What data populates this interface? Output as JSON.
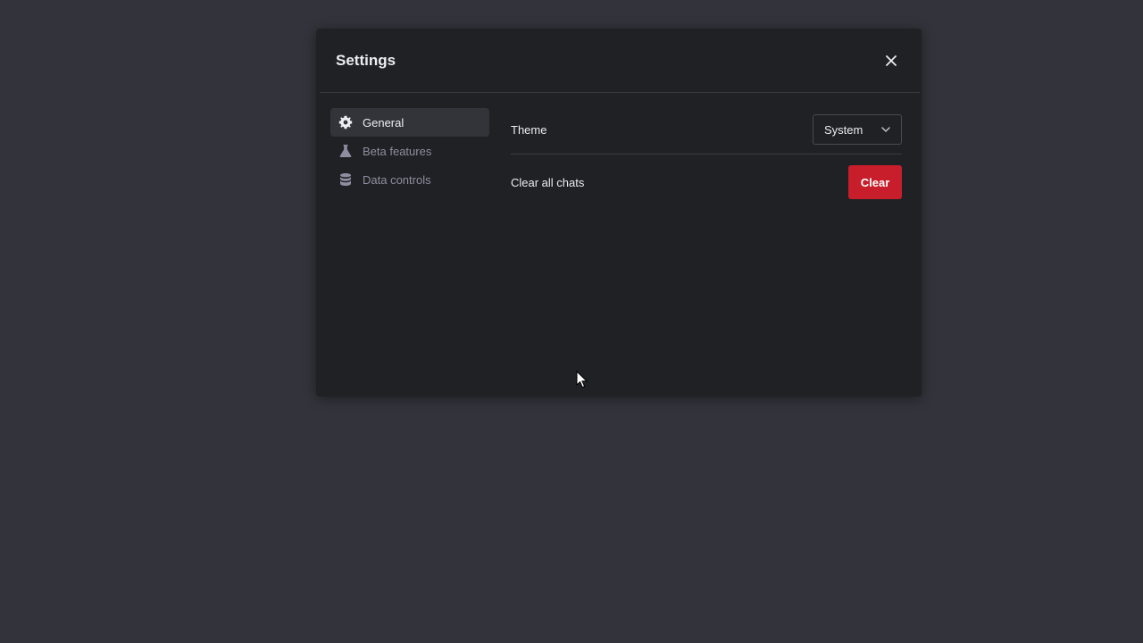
{
  "dialog": {
    "title": "Settings",
    "close_icon": "close-icon"
  },
  "sidebar": {
    "items": [
      {
        "label": "General",
        "icon": "gear-icon",
        "active": true
      },
      {
        "label": "Beta features",
        "icon": "flask-icon",
        "active": false
      },
      {
        "label": "Data controls",
        "icon": "database-icon",
        "active": false
      }
    ]
  },
  "general": {
    "theme_label": "Theme",
    "theme_value": "System",
    "clear_label": "Clear all chats",
    "clear_button": "Clear"
  },
  "colors": {
    "backdrop": "#33333b",
    "modal": "#202124",
    "danger": "#c81d2a",
    "active_item": "#33343a"
  }
}
